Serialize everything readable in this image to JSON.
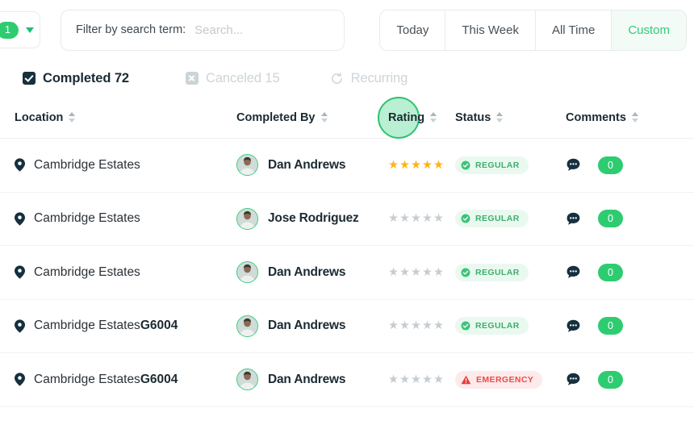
{
  "toolbar": {
    "filter_count": "1",
    "dropdown_icon": "chevron-down-icon",
    "search_label": "Filter by search term:",
    "search_value": "",
    "search_placeholder": "Search...",
    "range_tabs": [
      {
        "label": "Today",
        "active": false
      },
      {
        "label": "This Week",
        "active": false
      },
      {
        "label": "All Time",
        "active": false
      },
      {
        "label": "Custom",
        "active": true
      }
    ]
  },
  "status_filters": [
    {
      "label": "Completed 72",
      "icon": "checkbox-checked-icon",
      "active": true
    },
    {
      "label": "Canceled 15",
      "icon": "close-box-icon",
      "active": false
    },
    {
      "label": "Recurring",
      "icon": "refresh-icon",
      "active": false
    }
  ],
  "table": {
    "columns": [
      {
        "label": "Location",
        "sortable": true,
        "highlighted": false
      },
      {
        "label": "Completed By",
        "sortable": true,
        "highlighted": false
      },
      {
        "label": "Rating",
        "sortable": true,
        "highlighted": true
      },
      {
        "label": "Status",
        "sortable": true,
        "highlighted": false
      },
      {
        "label": "Comments",
        "sortable": true,
        "highlighted": false
      }
    ],
    "rows": [
      {
        "location": "Cambridge Estates",
        "location_suffix": "",
        "completed_by": "Dan Andrews",
        "rating": 5,
        "status": "REGULAR",
        "status_kind": "regular",
        "comments": "0"
      },
      {
        "location": "Cambridge Estates",
        "location_suffix": "",
        "completed_by": "Jose Rodriguez",
        "rating": 0,
        "status": "REGULAR",
        "status_kind": "regular",
        "comments": "0"
      },
      {
        "location": "Cambridge Estates",
        "location_suffix": "",
        "completed_by": "Dan Andrews",
        "rating": 0,
        "status": "REGULAR",
        "status_kind": "regular",
        "comments": "0"
      },
      {
        "location": "Cambridge Estates",
        "location_suffix": "G6004",
        "completed_by": "Dan Andrews",
        "rating": 0,
        "status": "REGULAR",
        "status_kind": "regular",
        "comments": "0"
      },
      {
        "location": "Cambridge Estates",
        "location_suffix": "G6004",
        "completed_by": "Dan Andrews",
        "rating": 0,
        "status": "EMERGENCY",
        "status_kind": "emergency",
        "comments": "0"
      }
    ]
  },
  "colors": {
    "accent_green": "#2ecc71",
    "active_tab_green": "#34c97b",
    "star_gold": "#fcb417",
    "emergency_red": "#ea4b4b",
    "dark_text": "#1b2a33",
    "muted": "#cdd4d8"
  }
}
